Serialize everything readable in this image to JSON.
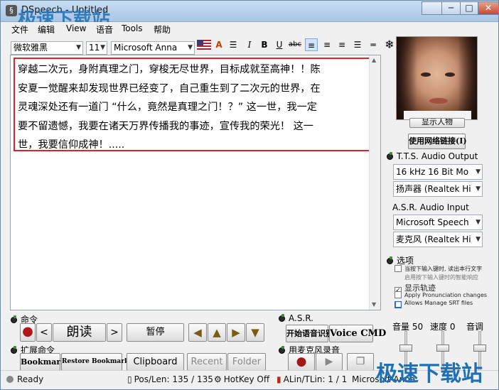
{
  "window": {
    "title": "DSpeech - Untitled",
    "minimize": "─",
    "maximize": "□",
    "close": "✕"
  },
  "watermark": "极速下载站",
  "menu": [
    "文件",
    "编辑",
    "View",
    "语音",
    "Tools",
    "帮助"
  ],
  "toolbar": {
    "font": "微软雅黑",
    "size": "11",
    "voice": "Microsoft Anna",
    "italic": "I",
    "bold": "B",
    "underline": "U",
    "strike": "abc"
  },
  "editor": {
    "lines": [
      "穿越二次元，身附真理之门，穿梭无尽世界，目标成就至高神！！陈",
      "安夏一觉醒来却发现世界已经变了，自己重生到了二次元的世界，在",
      "灵魂深处还有一道门 “什么，竟然是真理之门！？” 这一世，我一定",
      "要不留遗憾，我要在诸天万界传播我的事迹，宣传我的荣光！ 这一",
      "世，我要信仰成神！....."
    ]
  },
  "side": {
    "show_avatar": "显示人物",
    "use_network": "使用网络链接(I)",
    "tts_title": "T.T.S. Audio Output",
    "tts_format": "16 kHz 16 Bit Mo",
    "tts_device": "扬声器 (Realtek Hi",
    "asr_title": "A.S.R. Audio Input",
    "asr_engine": "Microsoft Speech",
    "asr_device": "麦克风 (Realtek Hi",
    "options_title": "选项",
    "opt1": "当按下输入键时, 读出本行文字",
    "opt2": "启用按下输入键时的智能响应",
    "opt3": "显示轨迹",
    "opt4": "Apply Pronunciation changes",
    "opt5": "Allows Manage SRT files",
    "volume": "音量 50",
    "rate": "速度 0",
    "pitch": "音调"
  },
  "commands": {
    "title": "命令",
    "speak": "朗读",
    "pause": "暂停",
    "ext_title": "扩展命令",
    "bookmarks": "Bookmarks",
    "restore": "Restore Bookmarks",
    "clipboard": "Clipboard",
    "recent": "Recent",
    "folder": "Folder",
    "asr_title": "A.S.R.",
    "start_asr": "开始语音识别",
    "voice_cmd": "Voice CMD",
    "record_title": "用麦克风录音"
  },
  "status": {
    "ready": "Ready",
    "poslen": "Pos/Len: 135 / 135",
    "hotkey": "HotKey Off",
    "alin": "ALin/TLin: 1 / 1",
    "voice": "Microsoft Anna"
  }
}
